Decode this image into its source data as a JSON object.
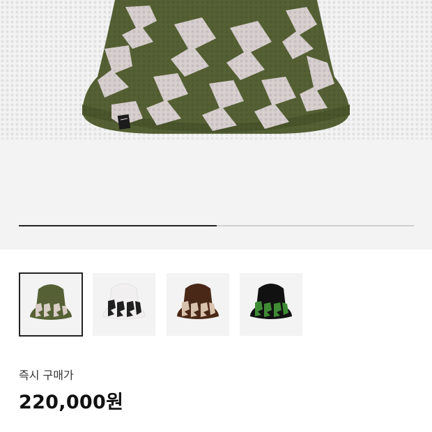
{
  "gallery": {
    "progress_fraction": 0.5,
    "thumbnails": [
      {
        "name": "olive",
        "body_color": "#556134",
        "pattern_color": "#d9cdc6",
        "selected": true
      },
      {
        "name": "white",
        "body_color": "#f1eff0",
        "pattern_color": "#202020",
        "selected": false
      },
      {
        "name": "brown",
        "body_color": "#4a2817",
        "pattern_color": "#d8c2ad",
        "selected": false
      },
      {
        "name": "green",
        "body_color": "#111111",
        "pattern_color": "#3f8a35",
        "selected": false
      }
    ]
  },
  "price": {
    "label": "즉시 구매가",
    "value": "220,000원"
  },
  "colors": {
    "hat_olive": "#556134",
    "hat_pattern": "#d8cfcf"
  }
}
